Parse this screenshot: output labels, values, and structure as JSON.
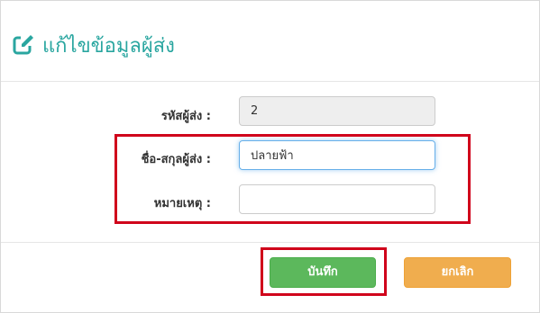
{
  "dialog": {
    "title": "แก้ไขข้อมูลผู้ส่ง",
    "title_color": "#2aa6a0",
    "title_icon": "edit-icon"
  },
  "form": {
    "sender_id": {
      "label": "รหัสผู้ส่ง :",
      "value": "2"
    },
    "sender_name": {
      "label": "ชื่อ-สกุลผู้ส่ง :",
      "value": "ปลายฟ้า"
    },
    "remark": {
      "label": "หมายเหตุ :",
      "value": ""
    }
  },
  "buttons": {
    "save_label": "บันทึก",
    "cancel_label": "ยกเลิก"
  },
  "colors": {
    "save": "#5cb85c",
    "cancel": "#f0ad4e",
    "highlight": "#d0021b"
  }
}
